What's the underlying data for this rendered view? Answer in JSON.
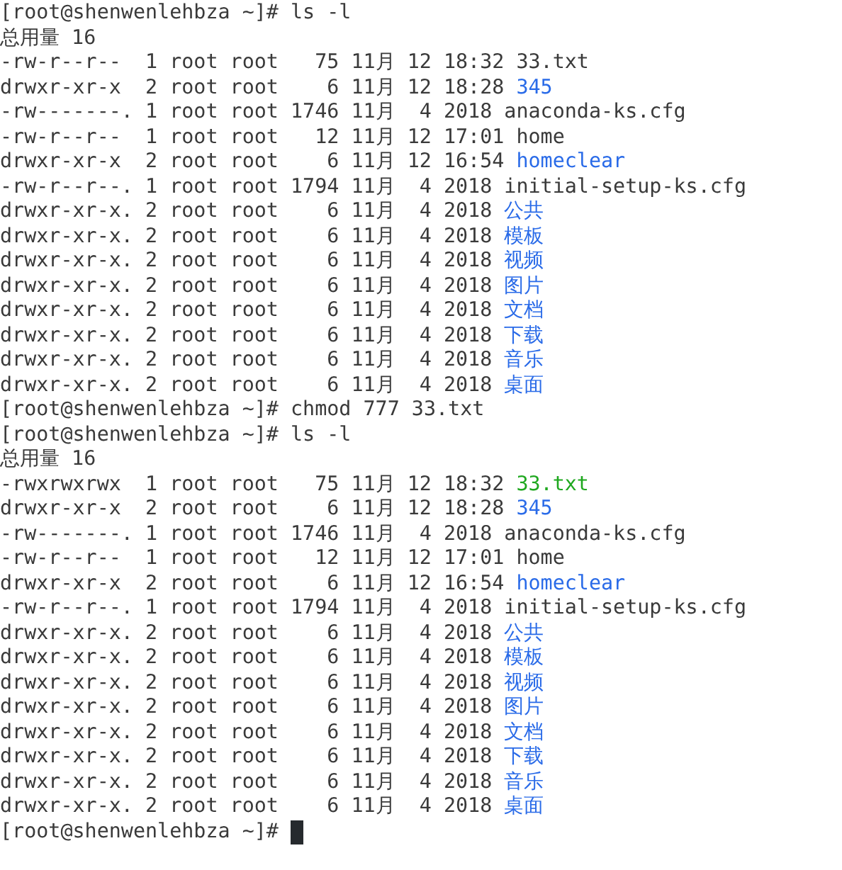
{
  "terminal": {
    "lines": [
      {
        "kind": "prompt",
        "text": "[root@shenwenlehbza ~]# ls -l"
      },
      {
        "kind": "total",
        "text": "总用量 16"
      },
      {
        "kind": "entry",
        "info": "-rw-r--r--  1 root root   75 11月 12 18:32 ",
        "name": "33.txt",
        "color": "#3a3a3a"
      },
      {
        "kind": "entry",
        "info": "drwxr-xr-x  2 root root    6 11月 12 18:28 ",
        "name": "345",
        "color": "#2a6be8"
      },
      {
        "kind": "entry",
        "info": "-rw-------. 1 root root 1746 11月  4 2018 ",
        "name": "anaconda-ks.cfg",
        "color": "#3a3a3a"
      },
      {
        "kind": "entry",
        "info": "-rw-r--r--  1 root root   12 11月 12 17:01 ",
        "name": "home",
        "color": "#3a3a3a"
      },
      {
        "kind": "entry",
        "info": "drwxr-xr-x  2 root root    6 11月 12 16:54 ",
        "name": "homeclear",
        "color": "#2a6be8"
      },
      {
        "kind": "entry",
        "info": "-rw-r--r--. 1 root root 1794 11月  4 2018 ",
        "name": "initial-setup-ks.cfg",
        "color": "#3a3a3a"
      },
      {
        "kind": "entry",
        "info": "drwxr-xr-x. 2 root root    6 11月  4 2018 ",
        "name": "公共",
        "color": "#2a6be8"
      },
      {
        "kind": "entry",
        "info": "drwxr-xr-x. 2 root root    6 11月  4 2018 ",
        "name": "模板",
        "color": "#2a6be8"
      },
      {
        "kind": "entry",
        "info": "drwxr-xr-x. 2 root root    6 11月  4 2018 ",
        "name": "视频",
        "color": "#2a6be8"
      },
      {
        "kind": "entry",
        "info": "drwxr-xr-x. 2 root root    6 11月  4 2018 ",
        "name": "图片",
        "color": "#2a6be8"
      },
      {
        "kind": "entry",
        "info": "drwxr-xr-x. 2 root root    6 11月  4 2018 ",
        "name": "文档",
        "color": "#2a6be8"
      },
      {
        "kind": "entry",
        "info": "drwxr-xr-x. 2 root root    6 11月  4 2018 ",
        "name": "下载",
        "color": "#2a6be8"
      },
      {
        "kind": "entry",
        "info": "drwxr-xr-x. 2 root root    6 11月  4 2018 ",
        "name": "音乐",
        "color": "#2a6be8"
      },
      {
        "kind": "entry",
        "info": "drwxr-xr-x. 2 root root    6 11月  4 2018 ",
        "name": "桌面",
        "color": "#2a6be8"
      },
      {
        "kind": "prompt",
        "text": "[root@shenwenlehbza ~]# chmod 777 33.txt"
      },
      {
        "kind": "prompt",
        "text": "[root@shenwenlehbza ~]# ls -l"
      },
      {
        "kind": "total",
        "text": "总用量 16"
      },
      {
        "kind": "entry",
        "info": "-rwxrwxrwx  1 root root   75 11月 12 18:32 ",
        "name": "33.txt",
        "color": "#1fa81f"
      },
      {
        "kind": "entry",
        "info": "drwxr-xr-x  2 root root    6 11月 12 18:28 ",
        "name": "345",
        "color": "#2a6be8"
      },
      {
        "kind": "entry",
        "info": "-rw-------. 1 root root 1746 11月  4 2018 ",
        "name": "anaconda-ks.cfg",
        "color": "#3a3a3a"
      },
      {
        "kind": "entry",
        "info": "-rw-r--r--  1 root root   12 11月 12 17:01 ",
        "name": "home",
        "color": "#3a3a3a"
      },
      {
        "kind": "entry",
        "info": "drwxr-xr-x  2 root root    6 11月 12 16:54 ",
        "name": "homeclear",
        "color": "#2a6be8"
      },
      {
        "kind": "entry",
        "info": "-rw-r--r--. 1 root root 1794 11月  4 2018 ",
        "name": "initial-setup-ks.cfg",
        "color": "#3a3a3a"
      },
      {
        "kind": "entry",
        "info": "drwxr-xr-x. 2 root root    6 11月  4 2018 ",
        "name": "公共",
        "color": "#2a6be8"
      },
      {
        "kind": "entry",
        "info": "drwxr-xr-x. 2 root root    6 11月  4 2018 ",
        "name": "模板",
        "color": "#2a6be8"
      },
      {
        "kind": "entry",
        "info": "drwxr-xr-x. 2 root root    6 11月  4 2018 ",
        "name": "视频",
        "color": "#2a6be8"
      },
      {
        "kind": "entry",
        "info": "drwxr-xr-x. 2 root root    6 11月  4 2018 ",
        "name": "图片",
        "color": "#2a6be8"
      },
      {
        "kind": "entry",
        "info": "drwxr-xr-x. 2 root root    6 11月  4 2018 ",
        "name": "文档",
        "color": "#2a6be8"
      },
      {
        "kind": "entry",
        "info": "drwxr-xr-x. 2 root root    6 11月  4 2018 ",
        "name": "下载",
        "color": "#2a6be8"
      },
      {
        "kind": "entry",
        "info": "drwxr-xr-x. 2 root root    6 11月  4 2018 ",
        "name": "音乐",
        "color": "#2a6be8"
      },
      {
        "kind": "entry",
        "info": "drwxr-xr-x. 2 root root    6 11月  4 2018 ",
        "name": "桌面",
        "color": "#2a6be8"
      },
      {
        "kind": "prompt",
        "text": "[root@shenwenlehbza ~]# ",
        "cursor": true
      }
    ]
  }
}
